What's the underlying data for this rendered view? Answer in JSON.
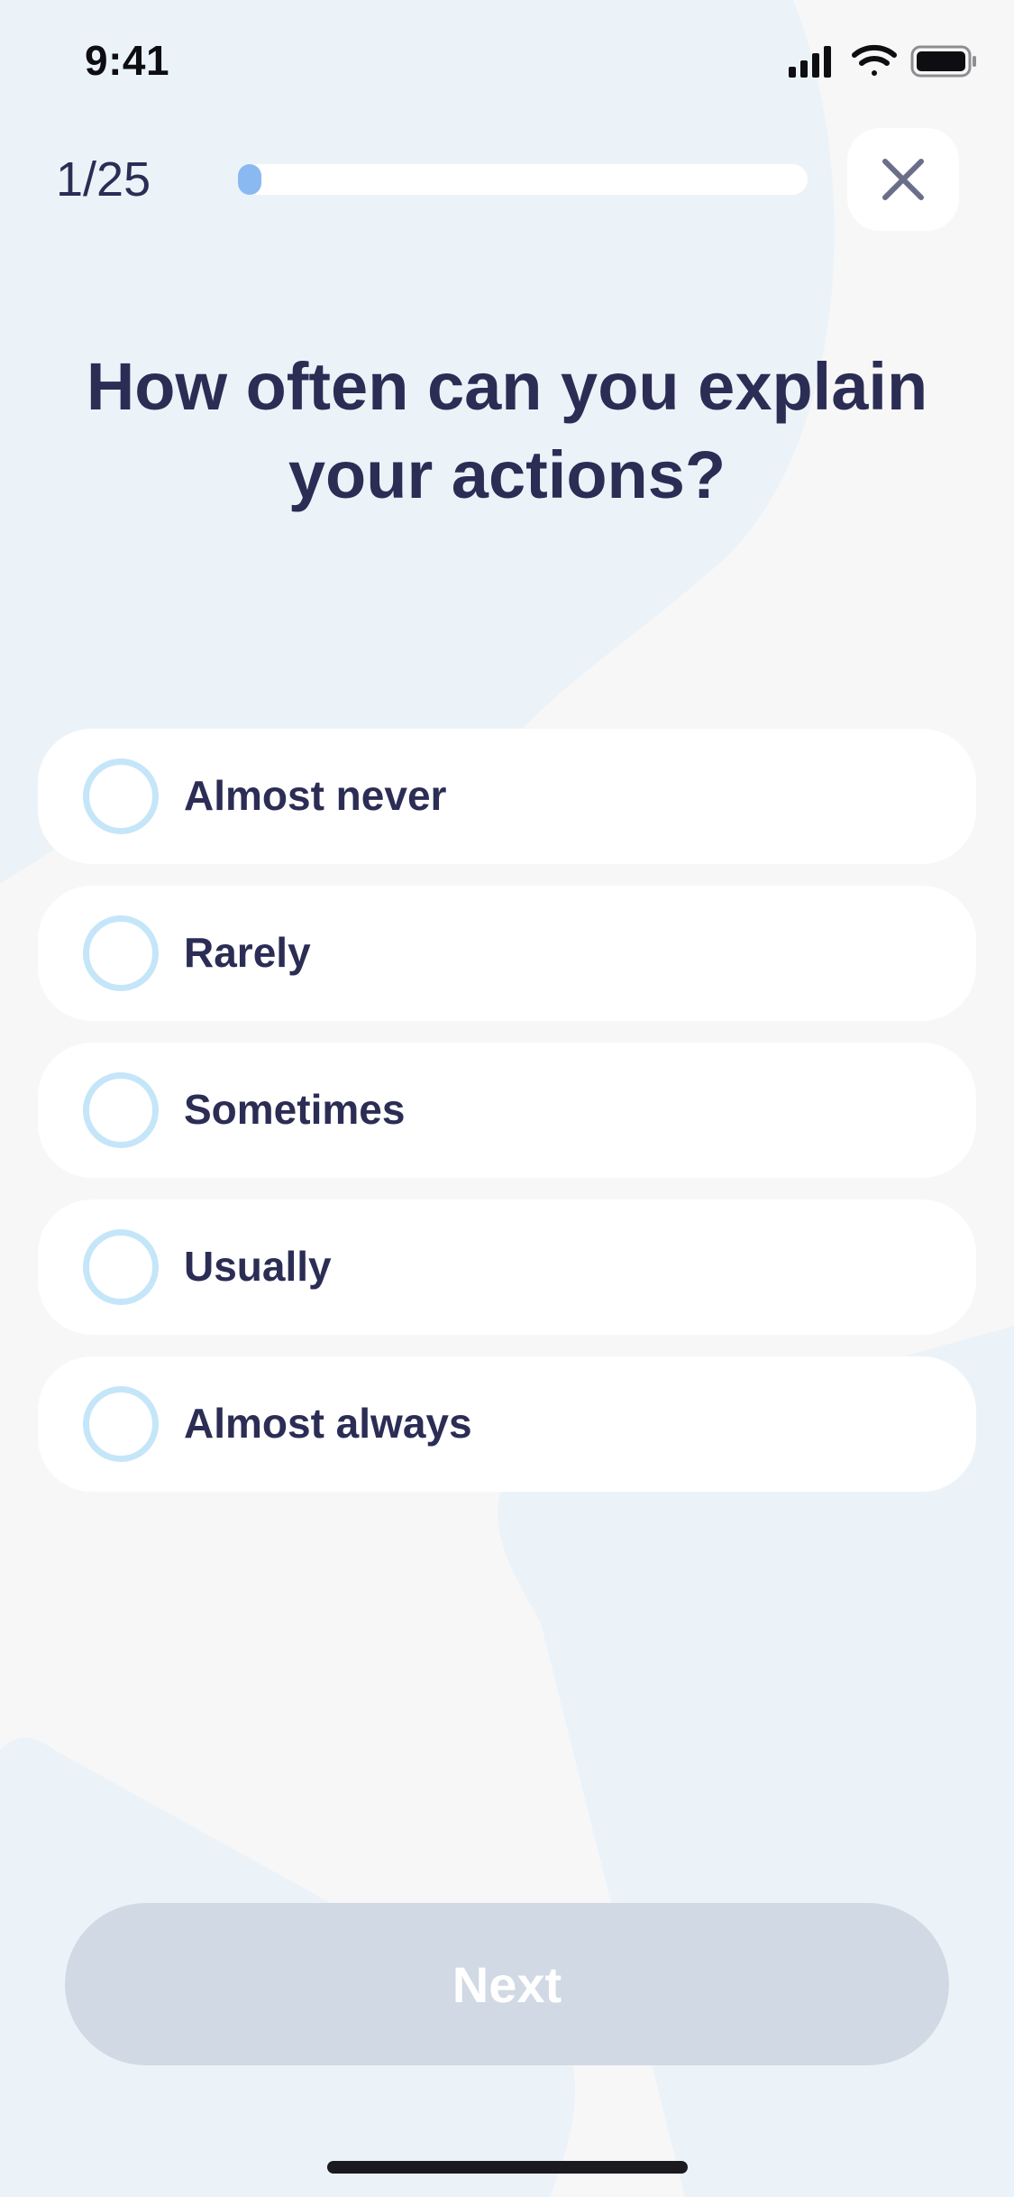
{
  "status_bar": {
    "time": "9:41",
    "icons": [
      "cellular-signal-icon",
      "wifi-icon",
      "battery-icon"
    ]
  },
  "header": {
    "counter": "1/25",
    "progress": {
      "current": 1,
      "total": 25
    },
    "close_icon": "close-icon"
  },
  "question": {
    "text": "How often can you explain your actions?"
  },
  "options": [
    {
      "label": "Almost never",
      "selected": false
    },
    {
      "label": "Rarely",
      "selected": false
    },
    {
      "label": "Sometimes",
      "selected": false
    },
    {
      "label": "Usually",
      "selected": false
    },
    {
      "label": "Almost always",
      "selected": false
    }
  ],
  "footer": {
    "next_label": "Next",
    "next_enabled": false
  },
  "colors": {
    "text_primary": "#2b2d55",
    "accent_blue": "#8ab9f2",
    "radio_ring": "#c4e6f8",
    "button_disabled": "#d1d9e5",
    "background_shape": "#ecf3f8"
  }
}
